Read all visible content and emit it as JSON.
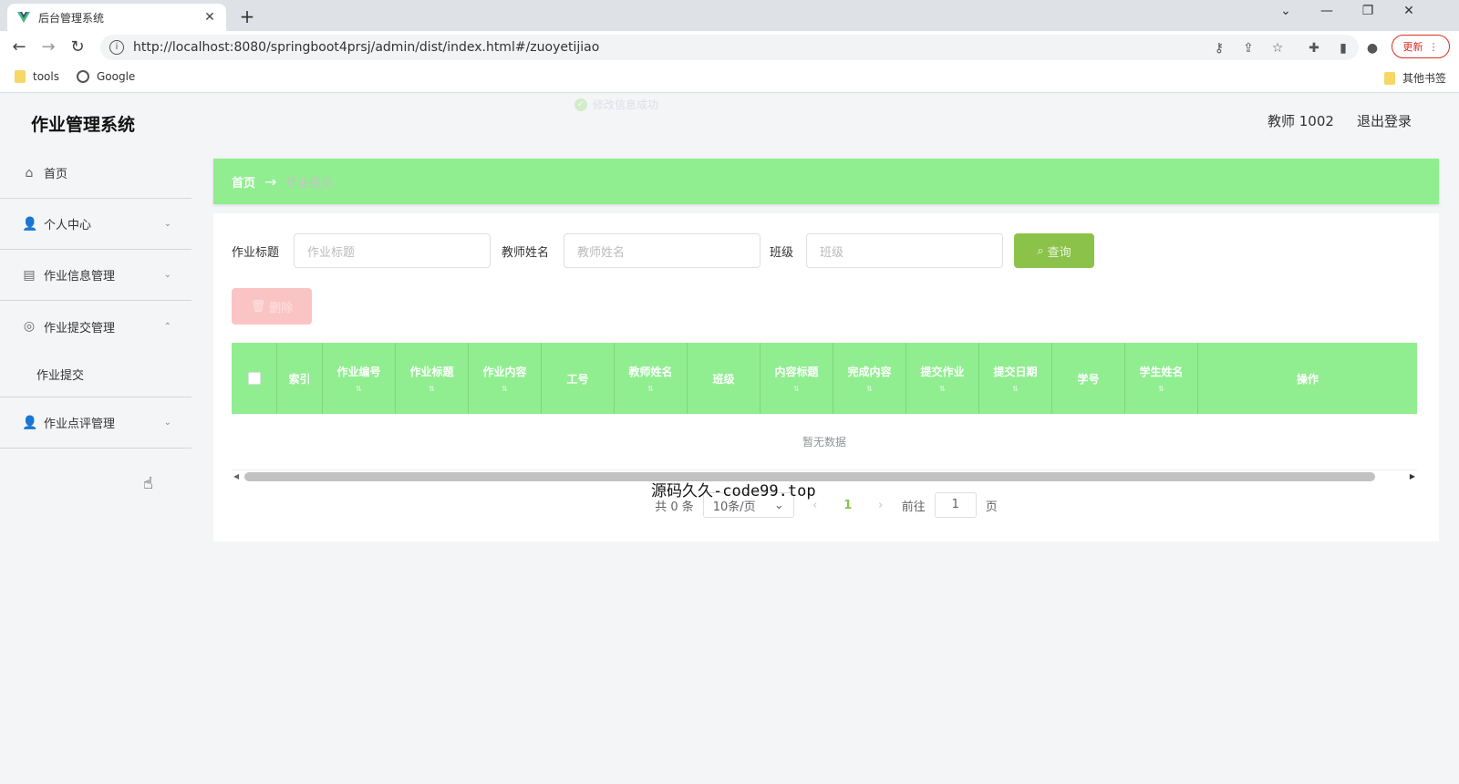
{
  "browser": {
    "tab_title": "后台管理系统",
    "tab_close": "✕",
    "new_tab": "+",
    "window_controls": [
      "⌄",
      "—",
      "❐",
      "✕"
    ],
    "nav": {
      "back": "←",
      "forward": "→",
      "reload": "↻"
    },
    "url": "http://localhost:8080/springboot4prsj/admin/dist/index.html#/zuoyetijiao",
    "update_label": "更新",
    "bookmarks": [
      {
        "label": "tools",
        "icon": "folder-icon"
      },
      {
        "label": "Google",
        "icon": "globe-icon"
      }
    ],
    "other_bookmarks": "其他书签"
  },
  "app": {
    "title": "作业管理系统",
    "user": "教师 1002",
    "logout": "退出登录",
    "toast": "修改信息成功"
  },
  "sidebar": {
    "items": [
      {
        "label": "首页",
        "icon": "home-icon",
        "chevron": ""
      },
      {
        "label": "个人中心",
        "icon": "user-icon",
        "chevron": "⌄"
      },
      {
        "label": "作业信息管理",
        "icon": "form-icon",
        "chevron": "⌄"
      },
      {
        "label": "作业提交管理",
        "icon": "target-icon",
        "chevron": "⌃"
      },
      {
        "label": "作业点评管理",
        "icon": "user-icon",
        "chevron": "⌄"
      }
    ],
    "sub_item": "作业提交"
  },
  "breadcrumb": {
    "home": "首页",
    "arrow": "→",
    "current": "作业提交"
  },
  "filters": {
    "title_label": "作业标题",
    "title_placeholder": "作业标题",
    "teacher_label": "教师姓名",
    "teacher_placeholder": "教师姓名",
    "class_label": "班级",
    "class_placeholder": "班级",
    "search_label": "查询",
    "delete_label": "删除"
  },
  "table": {
    "columns": [
      "索引",
      "作业编号",
      "作业标题",
      "作业内容",
      "工号",
      "教师姓名",
      "班级",
      "内容标题",
      "完成内容",
      "提交作业",
      "提交日期",
      "学号",
      "学生姓名",
      "操作"
    ],
    "empty_text": "暂无数据"
  },
  "pagination": {
    "total": "共 0 条",
    "page_size": "10条/页",
    "prev": "‹",
    "current": "1",
    "next": "›",
    "goto_label": "前往",
    "goto_value": "1",
    "page_suffix": "页"
  },
  "watermark": "源码久久-code99.top",
  "colors": {
    "accent_green": "#90ee90",
    "button_green": "#8bc34a",
    "delete_pink": "#fbc4c4"
  }
}
